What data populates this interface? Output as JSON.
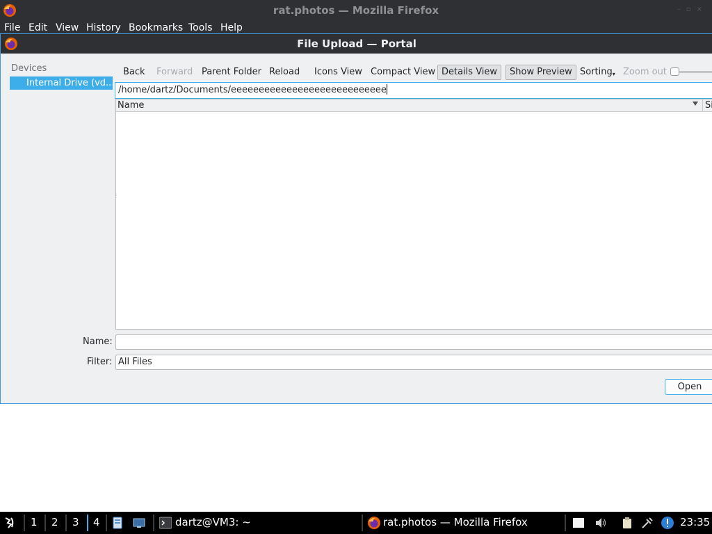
{
  "browser": {
    "window_title": "rat.photos — Mozilla Firefox",
    "menu": [
      "File",
      "Edit",
      "View",
      "History",
      "Bookmarks",
      "Tools",
      "Help"
    ]
  },
  "dialog": {
    "title": "File Upload — Portal",
    "places": {
      "header": "Devices",
      "items": [
        {
          "label": "Internal Drive (vd..."
        }
      ]
    },
    "toolbar": {
      "back": "Back",
      "forward": "Forward",
      "parent_folder": "Parent Folder",
      "reload": "Reload",
      "icons_view": "Icons View",
      "compact_view": "Compact View",
      "details_view": "Details View",
      "show_preview": "Show Preview",
      "sorting": "Sorting",
      "zoom_out": "Zoom out"
    },
    "path": "/home/dartz/Documents/eeeeeeeeeeeeeeeeeeeeeeeeeeee",
    "columns": {
      "name": "Name",
      "size": "Si"
    },
    "name_label": "Name:",
    "name_value": "",
    "filter_label": "Filter:",
    "filter_value": "All Files",
    "open_button": "Open"
  },
  "taskbar": {
    "workspaces": [
      "1",
      "2",
      "3",
      "4"
    ],
    "active_workspace": "4",
    "terminal_task": "dartz@VM3: ~",
    "firefox_task": "rat.photos — Mozilla Firefox",
    "clock": "23:35"
  },
  "colors": {
    "accent": "#3daee9",
    "titlebar": "#2e3034",
    "dialog_bg": "#eff0f1"
  }
}
